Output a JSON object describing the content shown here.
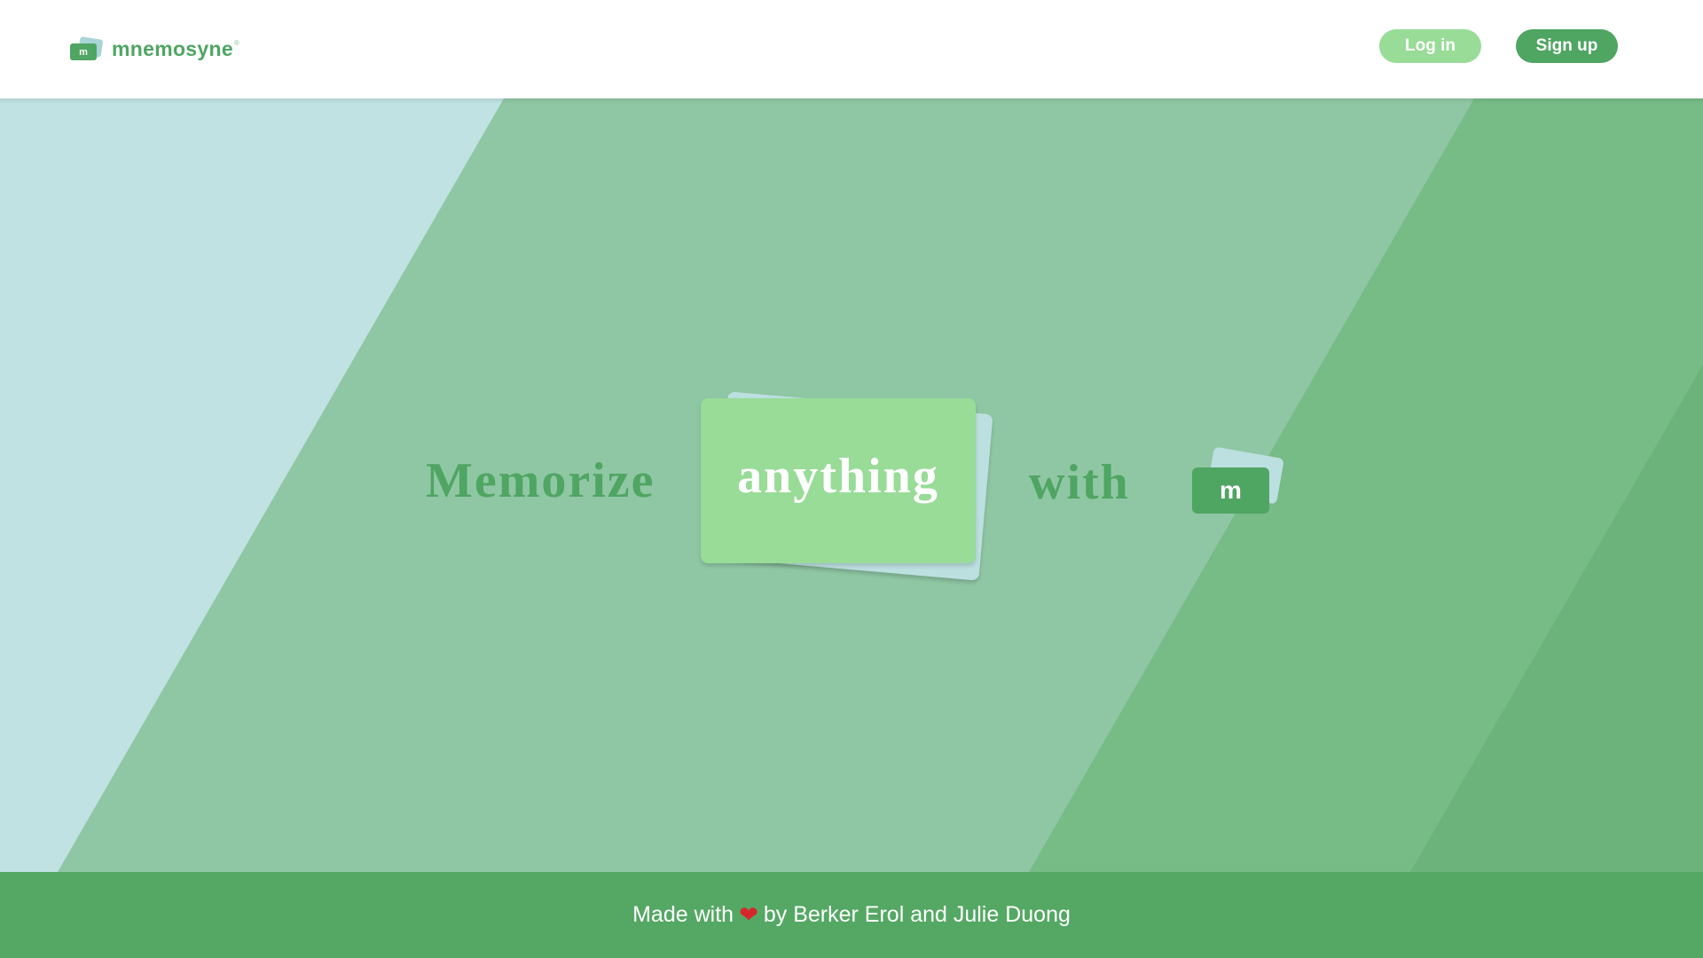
{
  "header": {
    "logo_mark": "m",
    "brand": "mnemosyne",
    "brand_mark": "®",
    "login_label": "Log in",
    "signup_label": "Sign up"
  },
  "hero": {
    "word_1": "Memorize",
    "card_word": "anything",
    "word_2": "with",
    "mini_logo": "m"
  },
  "footer": {
    "prefix": "Made with",
    "heart_icon": "heart-icon",
    "heart": "❤",
    "suffix": "by Berker Erol and Julie Duong"
  },
  "colors": {
    "brand_green": "#4fa562",
    "light_green": "#98dc97",
    "pale_blue": "#c0e2e3",
    "footer_green": "#54a864"
  }
}
